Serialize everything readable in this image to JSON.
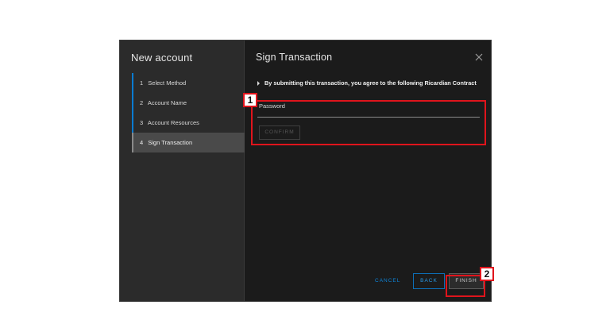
{
  "wizard": {
    "title": "New account",
    "steps": [
      {
        "num": "1",
        "label": "Select Method"
      },
      {
        "num": "2",
        "label": "Account Name"
      },
      {
        "num": "3",
        "label": "Account Resources"
      },
      {
        "num": "4",
        "label": "Sign Transaction"
      }
    ],
    "active_step": 4
  },
  "content": {
    "title": "Sign Transaction",
    "contract_text": "By submitting this transaction, you agree to the following Ricardian Contract",
    "password_label": "Password",
    "password_value": "",
    "confirm_label": "CONFIRM"
  },
  "footer": {
    "cancel_label": "CANCEL",
    "back_label": "BACK",
    "finish_label": "FINISH"
  },
  "annotations": [
    {
      "tag": "1"
    },
    {
      "tag": "2"
    }
  ],
  "colors": {
    "accent": "#0a7bd1",
    "highlight": "#e0141c",
    "dialog_bg": "#1b1b1b",
    "nav_bg": "#2b2b2b"
  },
  "icons": {
    "close": "close-icon",
    "caret": "caret-right-icon"
  }
}
